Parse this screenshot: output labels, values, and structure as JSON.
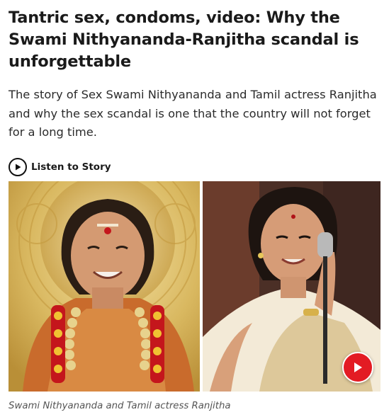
{
  "article": {
    "headline": "Tantric sex, condoms, video: Why the Swami Nithyananda-Ranjitha scandal is unforgettable",
    "summary": "The story of Sex Swami Nithyananda and Tamil actress Ranjitha and why the sex scandal is one that the country will not forget for a long time.",
    "listen_label": "Listen to Story",
    "caption": "Swami Nithyananda and Tamil actress Ranjitha"
  },
  "icons": {
    "listen": "play-circle-icon",
    "video": "play-icon"
  },
  "colors": {
    "play_button": "#e31b23",
    "headline": "#1a1a1a",
    "caption": "#555555"
  }
}
